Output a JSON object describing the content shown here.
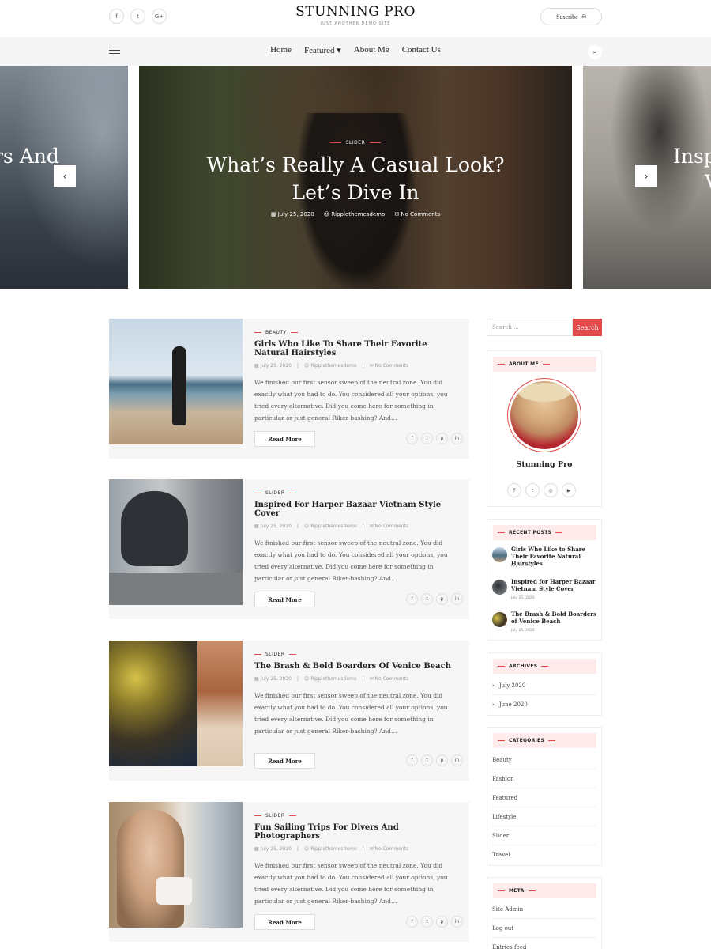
{
  "header": {
    "social": [
      {
        "icon": "facebook-icon",
        "glyph": "f"
      },
      {
        "icon": "twitter-icon",
        "glyph": "t"
      },
      {
        "icon": "google-plus-icon",
        "glyph": "G+"
      }
    ],
    "title": "STUNNING PRO",
    "tagline": "JUST ANOTHER DEMO SITE",
    "subscribe_label": "Suscribe"
  },
  "nav": {
    "items": [
      {
        "label": "Home"
      },
      {
        "label": "Featured ▾"
      },
      {
        "label": "About Me"
      },
      {
        "label": "Contact Us"
      }
    ]
  },
  "slider": {
    "left_partial": "rs And",
    "right_partial_1": "Insp",
    "right_partial_2": "V",
    "category": "SLIDER",
    "heading_line1": "What’s Really A Casual Look?",
    "heading_line2": "Let’s Dive In",
    "date": "July 25, 2020",
    "author": "Ripplethemesdemo",
    "comments": "No Comments"
  },
  "posts": [
    {
      "category": "BEAUTY",
      "title": "Girls Who Like To Share Their Favorite Natural Hairstyles",
      "date": "July 25, 2020",
      "author": "Ripplethemesdemo",
      "comments": "No Comments",
      "excerpt": "We finished our first sensor sweep of the neutral zone. You did exactly what you had to do. You considered all your options, you tried every alternative. Did you come here for something in particular or just general Riker-bashing? And…",
      "read_more": "Read More"
    },
    {
      "category": "SLIDER",
      "title": "Inspired For Harper Bazaar Vietnam Style Cover",
      "date": "July 25, 2020",
      "author": "Ripplethemesdemo",
      "comments": "No Comments",
      "excerpt": "We finished our first sensor sweep of the neutral zone. You did exactly what you had to do. You considered all your options, you tried every alternative. Did you come here for something in particular or just general Riker-bashing? And…",
      "read_more": "Read More"
    },
    {
      "category": "SLIDER",
      "title": "The Brash & Bold Boarders Of Venice Beach",
      "date": "July 25, 2020",
      "author": "Ripplethemesdemo",
      "comments": "No Comments",
      "excerpt": "We finished our first sensor sweep of the neutral zone. You did exactly what you had to do. You considered all your options, you tried every alternative. Did you come here for something in particular or just general Riker-bashing? And…",
      "read_more": "Read More"
    },
    {
      "category": "SLIDER",
      "title": "Fun Sailing Trips For Divers And Photographers",
      "date": "July 25, 2020",
      "author": "Ripplethemesdemo",
      "comments": "No Comments",
      "excerpt": "We finished our first sensor sweep of the neutral zone. You did exactly what you had to do. You considered all your options, you tried every alternative. Did you come here for something in particular or just general Riker-bashing? And…",
      "read_more": "Read More"
    }
  ],
  "sidebar": {
    "search_placeholder": "Search ...",
    "search_button": "Search",
    "about": {
      "title": "ABOUT ME",
      "name": "Stunning Pro"
    },
    "recent": {
      "title": "RECENT POSTS",
      "items": [
        {
          "title": "Girls Who Like to Share Their Favorite Natural Hairstyles",
          "date": "July 25, 2020"
        },
        {
          "title": "Inspired for Harper Bazaar Vietnam Style Cover",
          "date": "July 25, 2020"
        },
        {
          "title": "The Brash & Bold Boarders of Venice Beach",
          "date": "July 25, 2020"
        }
      ]
    },
    "archives": {
      "title": "ARCHIVES",
      "items": [
        "July 2020",
        "June 2020"
      ]
    },
    "categories": {
      "title": "CATEGORIES",
      "items": [
        "Beauty",
        "Fashion",
        "Featured",
        "Lifestyle",
        "Slider",
        "Travel"
      ]
    },
    "meta": {
      "title": "META",
      "items": [
        "Site Admin",
        "Log out",
        "Entries feed"
      ]
    }
  },
  "colors": {
    "accent": "#e34a4a",
    "widget_title_bg": "#fdeceb",
    "post_bg": "#f6f6f6"
  }
}
